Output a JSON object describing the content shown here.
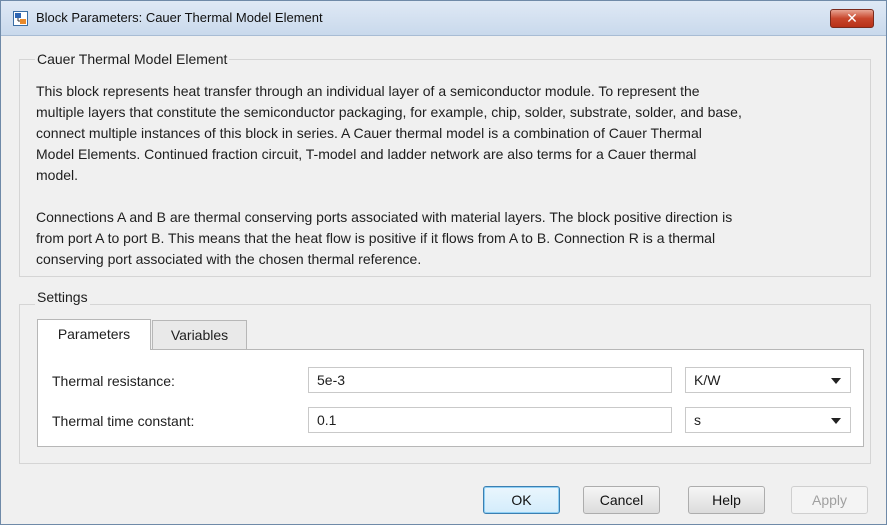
{
  "window": {
    "title": "Block Parameters: Cauer Thermal Model Element",
    "close_glyph": "✕"
  },
  "block": {
    "group_label": "Cauer Thermal Model Element",
    "description": [
      "This block represents heat transfer through an individual layer of a semiconductor module. To represent the",
      "multiple layers that constitute the semiconductor packaging, for example, chip, solder, substrate, solder, and base,",
      "connect multiple instances of this block in series. A Cauer thermal model is a combination of Cauer Thermal",
      "Model Elements. Continued fraction circuit, T-model and ladder network are also terms for a Cauer thermal",
      "model.",
      "",
      "Connections A and B are thermal conserving ports associated with material layers. The block positive direction is",
      "from port A to port B. This means that the heat flow is positive if it flows from A to B. Connection R is a thermal",
      "conserving port associated with the chosen thermal reference."
    ]
  },
  "settings": {
    "group_label": "Settings",
    "tabs": [
      {
        "label": "Parameters",
        "active": true
      },
      {
        "label": "Variables",
        "active": false
      }
    ],
    "parameters": [
      {
        "label": "Thermal resistance:",
        "value": "5e-3",
        "unit": "K/W"
      },
      {
        "label": "Thermal time constant:",
        "value": "0.1",
        "unit": "s"
      }
    ]
  },
  "buttons": {
    "ok": "OK",
    "cancel": "Cancel",
    "help": "Help",
    "apply": "Apply"
  },
  "colors": {
    "titlebar": "#c9d9ec",
    "close_button": "#c8462c",
    "default_button_border": "#3c7fb1"
  },
  "icons": {
    "app": "simulink-block-icon",
    "close": "close-icon",
    "dropdown": "chevron-down-icon"
  }
}
